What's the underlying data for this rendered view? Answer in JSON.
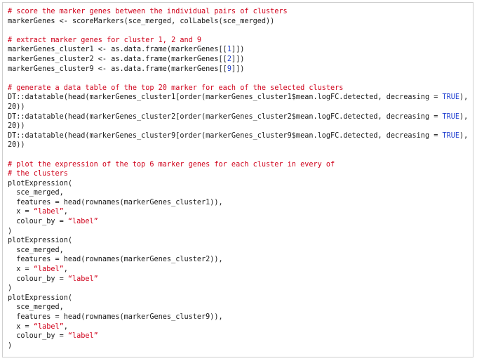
{
  "colors": {
    "comment": "#d0021b",
    "string": "#d0021b",
    "keyword": "#1f3fd0",
    "plain": "#1a1a1a",
    "border": "#cfcfcf"
  },
  "code": {
    "lines": [
      [
        {
          "t": "comment",
          "s": "# score the marker genes between the individual pairs of clusters"
        }
      ],
      [
        {
          "t": "plain",
          "s": "markerGenes <- scoreMarkers(sce_merged, colLabels(sce_merged))"
        }
      ],
      [],
      [
        {
          "t": "comment",
          "s": "# extract marker genes for cluster 1, 2 and 9"
        }
      ],
      [
        {
          "t": "plain",
          "s": "markerGenes_cluster1 <- as.data.frame(markerGenes[["
        },
        {
          "t": "keyword",
          "s": "1"
        },
        {
          "t": "plain",
          "s": "]])"
        }
      ],
      [
        {
          "t": "plain",
          "s": "markerGenes_cluster2 <- as.data.frame(markerGenes[["
        },
        {
          "t": "keyword",
          "s": "2"
        },
        {
          "t": "plain",
          "s": "]])"
        }
      ],
      [
        {
          "t": "plain",
          "s": "markerGenes_cluster9 <- as.data.frame(markerGenes[["
        },
        {
          "t": "keyword",
          "s": "9"
        },
        {
          "t": "plain",
          "s": "]])"
        }
      ],
      [],
      [
        {
          "t": "comment",
          "s": "# generate a data table of the top 20 marker for each of the selected clusters"
        }
      ],
      [
        {
          "t": "plain",
          "s": "DT::datatable(head(markerGenes_cluster1[order(markerGenes_cluster1$mean.logFC.detected, decreasing = "
        },
        {
          "t": "keyword",
          "s": "TRUE"
        },
        {
          "t": "plain",
          "s": "),], n ="
        }
      ],
      [
        {
          "t": "plain",
          "s": "20))"
        }
      ],
      [
        {
          "t": "plain",
          "s": "DT::datatable(head(markerGenes_cluster2[order(markerGenes_cluster2$mean.logFC.detected, decreasing = "
        },
        {
          "t": "keyword",
          "s": "TRUE"
        },
        {
          "t": "plain",
          "s": "),], n ="
        }
      ],
      [
        {
          "t": "plain",
          "s": "20))"
        }
      ],
      [
        {
          "t": "plain",
          "s": "DT::datatable(head(markerGenes_cluster9[order(markerGenes_cluster9$mean.logFC.detected, decreasing = "
        },
        {
          "t": "keyword",
          "s": "TRUE"
        },
        {
          "t": "plain",
          "s": "),], n ="
        }
      ],
      [
        {
          "t": "plain",
          "s": "20))"
        }
      ],
      [],
      [
        {
          "t": "comment",
          "s": "# plot the expression of the top 6 marker genes for each cluster in every of"
        }
      ],
      [
        {
          "t": "comment",
          "s": "# the clusters"
        }
      ],
      [
        {
          "t": "plain",
          "s": "plotExpression("
        }
      ],
      [
        {
          "t": "plain",
          "s": "  sce_merged,"
        }
      ],
      [
        {
          "t": "plain",
          "s": "  features = head(rownames(markerGenes_cluster1)),"
        }
      ],
      [
        {
          "t": "plain",
          "s": "  x = "
        },
        {
          "t": "string",
          "s": "“label”"
        },
        {
          "t": "plain",
          "s": ","
        }
      ],
      [
        {
          "t": "plain",
          "s": "  colour_by = "
        },
        {
          "t": "string",
          "s": "“label”"
        }
      ],
      [
        {
          "t": "plain",
          "s": ")"
        }
      ],
      [
        {
          "t": "plain",
          "s": "plotExpression("
        }
      ],
      [
        {
          "t": "plain",
          "s": "  sce_merged,"
        }
      ],
      [
        {
          "t": "plain",
          "s": "  features = head(rownames(markerGenes_cluster2)),"
        }
      ],
      [
        {
          "t": "plain",
          "s": "  x = "
        },
        {
          "t": "string",
          "s": "“label”"
        },
        {
          "t": "plain",
          "s": ","
        }
      ],
      [
        {
          "t": "plain",
          "s": "  colour_by = "
        },
        {
          "t": "string",
          "s": "“label”"
        }
      ],
      [
        {
          "t": "plain",
          "s": ")"
        }
      ],
      [
        {
          "t": "plain",
          "s": "plotExpression("
        }
      ],
      [
        {
          "t": "plain",
          "s": "  sce_merged,"
        }
      ],
      [
        {
          "t": "plain",
          "s": "  features = head(rownames(markerGenes_cluster9)),"
        }
      ],
      [
        {
          "t": "plain",
          "s": "  x = "
        },
        {
          "t": "string",
          "s": "“label”"
        },
        {
          "t": "plain",
          "s": ","
        }
      ],
      [
        {
          "t": "plain",
          "s": "  colour_by = "
        },
        {
          "t": "string",
          "s": "“label”"
        }
      ],
      [
        {
          "t": "plain",
          "s": ")"
        }
      ]
    ]
  }
}
